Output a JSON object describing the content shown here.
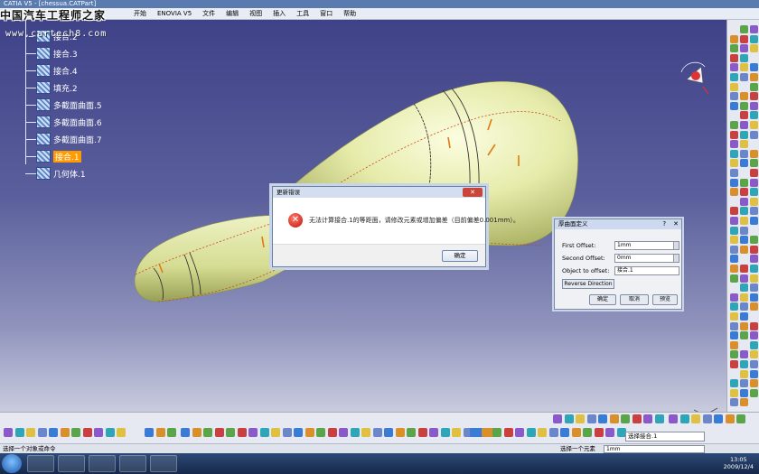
{
  "title": "CATIA V5 - [chessua.CATPart]",
  "watermark": "中国汽车工程师之家",
  "watermark_url": "www.cartech8.com",
  "menu": [
    "开始",
    "ENOVIA V5",
    "文件",
    "编辑",
    "视图",
    "插入",
    "工具",
    "窗口",
    "帮助"
  ],
  "tree": [
    {
      "label": "接合.2",
      "selected": false
    },
    {
      "label": "接合.3",
      "selected": false
    },
    {
      "label": "接合.4",
      "selected": false
    },
    {
      "label": "填充.2",
      "selected": false
    },
    {
      "label": "多截面曲面.5",
      "selected": false
    },
    {
      "label": "多截面曲面.6",
      "selected": false
    },
    {
      "label": "多截面曲面.7",
      "selected": false
    },
    {
      "label": "接合.1",
      "selected": true
    },
    {
      "label": "几何体.1",
      "selected": false
    }
  ],
  "error_dialog": {
    "title": "更新错误",
    "message": "无法计算接合.1的等距面，请修改元素或增加偏差（目前偏差0.001mm）。",
    "ok_label": "确定"
  },
  "offset_dialog": {
    "title": "厚曲面定义",
    "first_offset_label": "First Offset:",
    "first_offset_value": "1mm",
    "second_offset_label": "Second Offset:",
    "second_offset_value": "0mm",
    "object_label": "Object to offset:",
    "object_value": "接合.1",
    "reverse_label": "Reverse Direction",
    "ok_label": "确定",
    "cancel_label": "取消",
    "preview_label": "预览"
  },
  "status": {
    "text": "选择一个对象或命令",
    "right_text": "选择一个元素",
    "input_value": "1mm",
    "combo_value": "选择接合.1"
  },
  "clock": {
    "time": "13:05",
    "date": "2009/12/4"
  },
  "colors": {
    "surface": "#e8edb0",
    "accent": "#ff9a00",
    "error": "#c2120a"
  }
}
